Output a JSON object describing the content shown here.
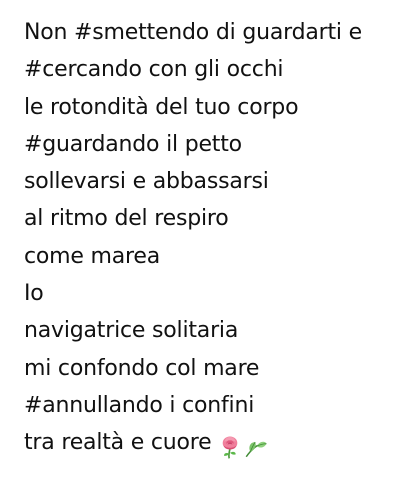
{
  "post": {
    "lines": [
      "Non #smettendo di guardarti e",
      "#cercando con gli occhi",
      "le rotondità del tuo corpo",
      "#guardando il petto",
      "sollevarsi e abbassarsi",
      "al ritmo del respiro",
      "come marea",
      "Io",
      "navigatrice solitaria",
      "mi confondo col mare",
      "#annullando i confini",
      "tra realtà e cuore"
    ],
    "emojis": [
      "rose-emoji",
      "leaf-emoji"
    ]
  }
}
